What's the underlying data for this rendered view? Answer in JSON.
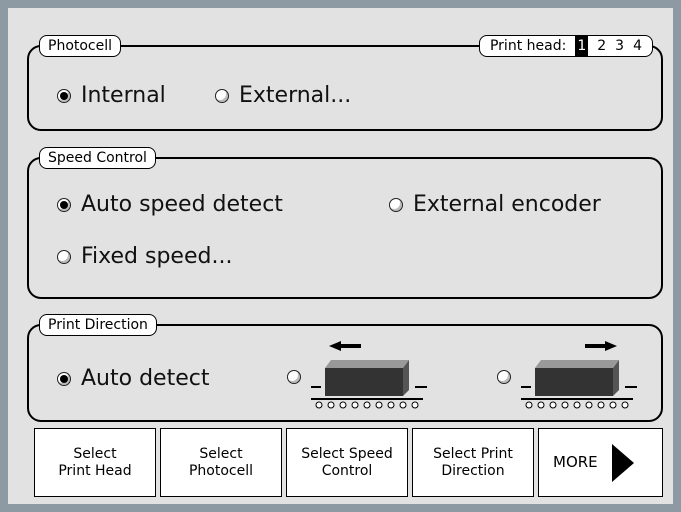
{
  "photocell": {
    "legend": "Photocell",
    "print_head_label": "Print head:",
    "heads": [
      "1",
      "2",
      "3",
      "4"
    ],
    "selected_head": "1",
    "options": [
      {
        "label": "Internal",
        "selected": true
      },
      {
        "label": "External...",
        "selected": false
      }
    ]
  },
  "speed": {
    "legend": "Speed Control",
    "options": [
      {
        "label": "Auto speed detect",
        "selected": true
      },
      {
        "label": "External encoder",
        "selected": false
      },
      {
        "label": "Fixed speed...",
        "selected": false
      }
    ]
  },
  "direction": {
    "legend": "Print Direction",
    "options": [
      {
        "label": "Auto detect",
        "selected": true
      },
      {
        "label": "",
        "icon": "left-direction-icon",
        "selected": false
      },
      {
        "label": "",
        "icon": "right-direction-icon",
        "selected": false
      }
    ]
  },
  "buttons": [
    {
      "line1": "Select",
      "line2": "Print Head"
    },
    {
      "line1": "Select",
      "line2": "Photocell"
    },
    {
      "line1": "Select Speed",
      "line2": "Control"
    },
    {
      "line1": "Select Print",
      "line2": "Direction"
    },
    {
      "line1": "MORE",
      "icon": "right-arrow-icon"
    }
  ]
}
